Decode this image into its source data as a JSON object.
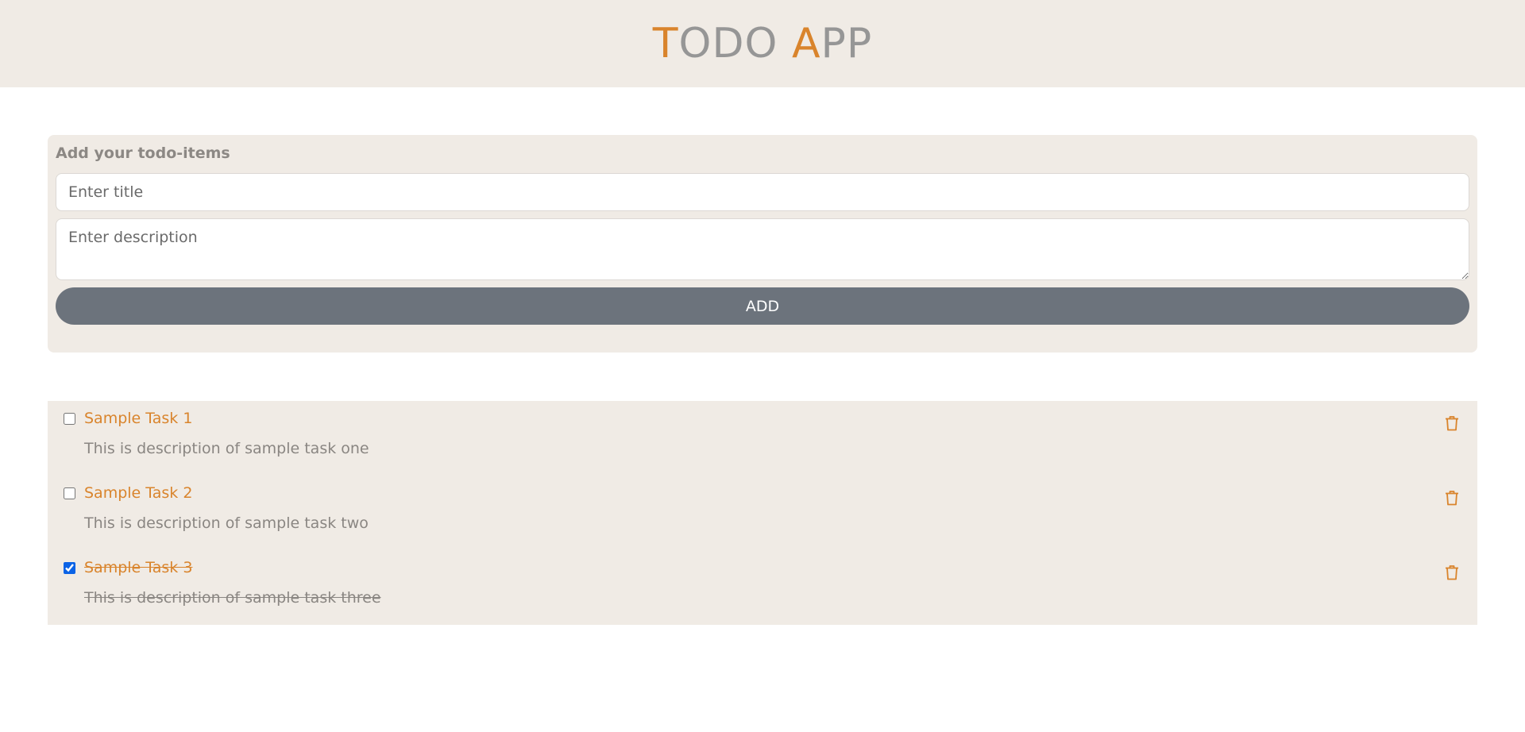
{
  "header": {
    "title_first_initial": "T",
    "title_first_rest": "ODO",
    "title_second_initial": "A",
    "title_second_rest": "PP"
  },
  "form": {
    "heading": "Add your todo-items",
    "title_placeholder": "Enter title",
    "title_value": "",
    "description_placeholder": "Enter description",
    "description_value": "",
    "add_label": "ADD"
  },
  "tasks": [
    {
      "title": "Sample Task 1",
      "description": "This is description of sample task one",
      "done": false,
      "delete_icon": "trash-icon"
    },
    {
      "title": "Sample Task 2",
      "description": "This is description of sample task two",
      "done": false,
      "delete_icon": "trash-icon"
    },
    {
      "title": "Sample Task 3",
      "description": "This is description of sample task three",
      "done": true,
      "delete_icon": "trash-icon"
    }
  ],
  "colors": {
    "accent": "#d9842c",
    "panel_bg": "#f0ebe5",
    "button_bg": "#6c737c",
    "muted_text": "#8a8682",
    "checkbox_checked": "#0b63e6"
  }
}
